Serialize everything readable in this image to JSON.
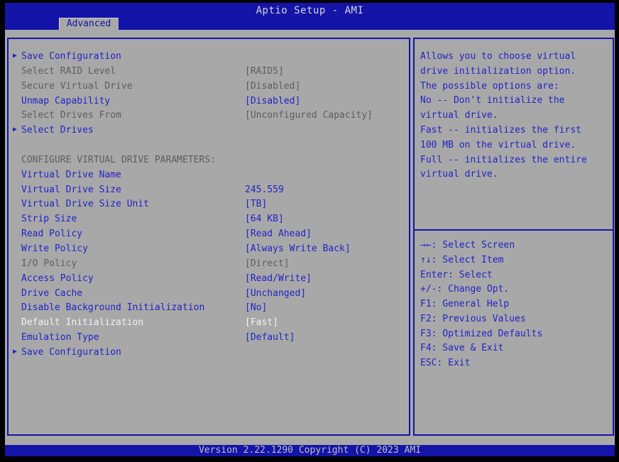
{
  "header": {
    "title": "Aptio Setup - AMI",
    "tab": "Advanced"
  },
  "menu": {
    "items": [
      {
        "label": "Save Configuration",
        "value": "",
        "state": "normal",
        "arrow": true
      },
      {
        "label": "Select RAID Level",
        "value": "[RAID5]",
        "state": "grayed",
        "arrow": false
      },
      {
        "label": "Secure Virtual Drive",
        "value": "[Disabled]",
        "state": "grayed",
        "arrow": false
      },
      {
        "label": "Unmap Capability",
        "value": "[Disabled]",
        "state": "normal",
        "arrow": false
      },
      {
        "label": "Select Drives From",
        "value": "[Unconfigured Capacity]",
        "state": "grayed",
        "arrow": false
      },
      {
        "label": "Select Drives",
        "value": "",
        "state": "normal",
        "arrow": true
      },
      {
        "type": "spacer"
      },
      {
        "label": "CONFIGURE VIRTUAL DRIVE PARAMETERS:",
        "value": "",
        "state": "grayed",
        "arrow": false
      },
      {
        "label": "Virtual Drive Name",
        "value": "",
        "state": "normal",
        "arrow": false
      },
      {
        "label": "Virtual Drive Size",
        "value": "245.559",
        "state": "normal",
        "arrow": false
      },
      {
        "label": "Virtual Drive Size Unit",
        "value": "[TB]",
        "state": "normal",
        "arrow": false
      },
      {
        "label": "Strip Size",
        "value": "[64 KB]",
        "state": "normal",
        "arrow": false
      },
      {
        "label": "Read Policy",
        "value": "[Read Ahead]",
        "state": "normal",
        "arrow": false
      },
      {
        "label": "Write Policy",
        "value": "[Always Write Back]",
        "state": "normal",
        "arrow": false
      },
      {
        "label": "I/O Policy",
        "value": "[Direct]",
        "state": "grayed",
        "arrow": false
      },
      {
        "label": "Access Policy",
        "value": "[Read/Write]",
        "state": "normal",
        "arrow": false
      },
      {
        "label": "Drive Cache",
        "value": "[Unchanged]",
        "state": "normal",
        "arrow": false
      },
      {
        "label": "Disable Background Initialization",
        "value": "[No]",
        "state": "normal",
        "arrow": false
      },
      {
        "label": "Default Initialization",
        "value": "[Fast]",
        "state": "selected",
        "arrow": false
      },
      {
        "label": "Emulation Type",
        "value": "[Default]",
        "state": "normal",
        "arrow": false
      },
      {
        "label": "Save Configuration",
        "value": "",
        "state": "normal",
        "arrow": true
      }
    ]
  },
  "help": {
    "lines": [
      "Allows you to choose virtual",
      "drive initialization option.",
      "The possible options are:",
      "No -- Don't initialize the",
      "virtual drive.",
      "Fast -- initializes the first",
      "100 MB on the virtual drive.",
      "Full -- initializes the entire",
      "virtual drive."
    ]
  },
  "keys": {
    "lines": [
      "→←: Select Screen",
      "↑↓: Select Item",
      "Enter: Select",
      "+/-: Change Opt.",
      "F1: General Help",
      "F2: Previous Values",
      "F3: Optimized Defaults",
      "F4: Save & Exit",
      "ESC: Exit"
    ]
  },
  "footer": {
    "version": "Version 2.22.1290 Copyright (C) 2023 AMI"
  },
  "colors": {
    "bar_blue": "#1414a8",
    "background_gray": "#a8a8a8",
    "item_blue": "#2323c9",
    "grayed_text": "#5e5e5e",
    "selected_text": "#f2f2f2",
    "title_text": "#d4d4d4",
    "frame_black": "#000000"
  }
}
